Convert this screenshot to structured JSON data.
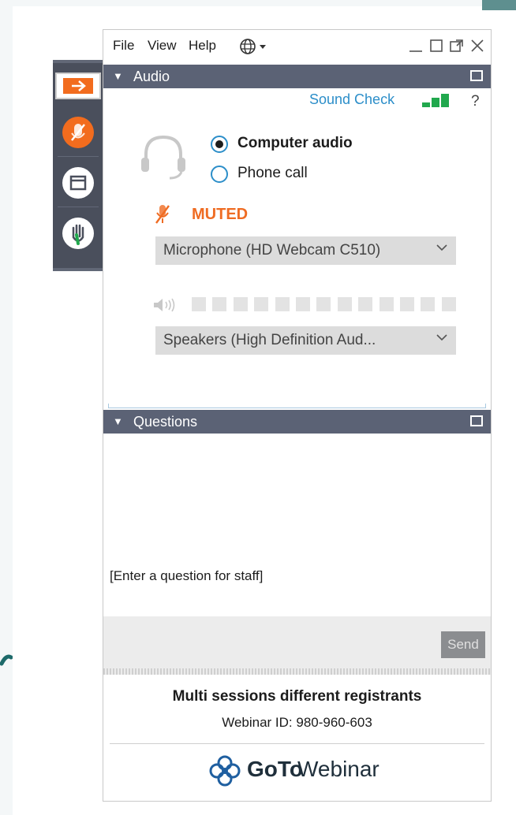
{
  "menu": {
    "file": "File",
    "view": "View",
    "help": "Help"
  },
  "audio": {
    "header": "Audio",
    "sound_check": "Sound Check",
    "help": "?",
    "computer_audio": "Computer audio",
    "phone_call": "Phone call",
    "selected_mode": "Computer audio",
    "muted": "MUTED",
    "microphone": "Microphone (HD Webcam C510)",
    "speakers": "Speakers (High Definition Aud...",
    "mic_level_segments": 13,
    "mic_level_active": 0
  },
  "questions": {
    "header": "Questions",
    "placeholder": "[Enter a question for staff]",
    "send": "Send"
  },
  "footer": {
    "session_title": "Multi sessions different registrants",
    "webinar_id": "Webinar ID: 980-960-603",
    "brand_bold": "GoTo",
    "brand_light": "Webinar"
  },
  "colors": {
    "accent_orange": "#ef6c23",
    "accent_blue": "#2c8ec9",
    "header_bg": "#5b6275",
    "signal_green": "#21a84d"
  }
}
